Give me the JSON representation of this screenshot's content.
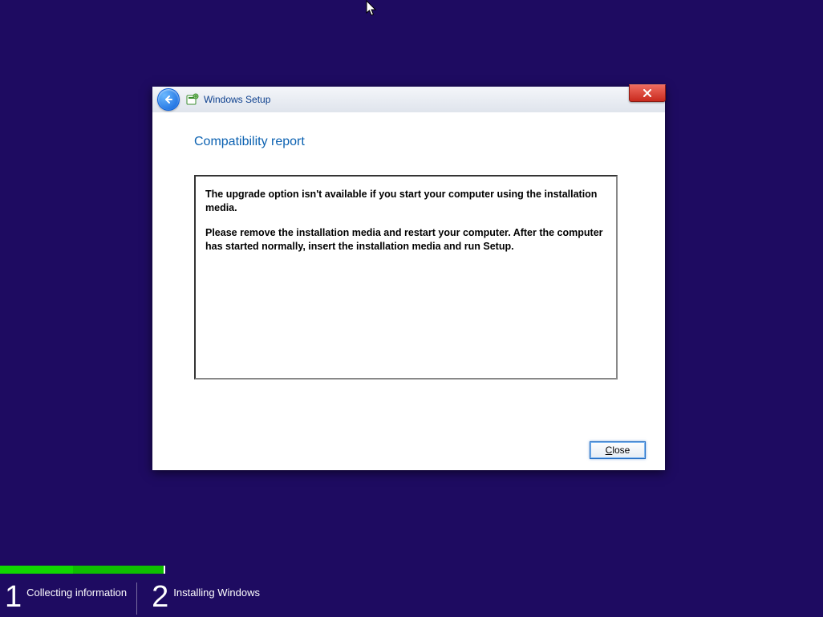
{
  "dialog": {
    "title": "Windows Setup",
    "heading": "Compatibility report",
    "message1": "The upgrade option isn't available if you start your computer using the installation media.",
    "message2": "Please remove the installation media and restart your computer. After the computer has started normally, insert the installation media and run Setup.",
    "close_label_u": "C",
    "close_label_rest": "lose"
  },
  "steps": {
    "step1_num": "1",
    "step1_label": "Collecting information",
    "step2_num": "2",
    "step2_label": "Installing Windows"
  }
}
